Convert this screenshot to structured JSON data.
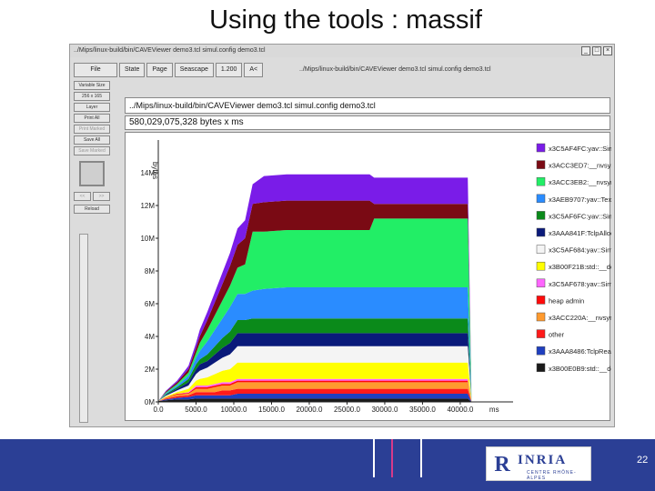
{
  "slide": {
    "title": "Using the tools : massif",
    "page_number": "22",
    "logo_text": "INRIA",
    "logo_sub": "CENTRE RHÔNE-ALPES"
  },
  "window": {
    "title": "../Mips/linux-build/bin/CAVEViewer demo3.tcl simul.config demo3.tcl",
    "buttons": [
      "_",
      "□",
      "×"
    ]
  },
  "menu": {
    "file": "File",
    "state": "State",
    "page": "Page",
    "seascape": "Seascape",
    "zoom": "1.200",
    "back": "A<",
    "path": "../Mips/linux-build/bin/CAVEViewer demo3.tcl simul.config demo3.tcl"
  },
  "sidebar": {
    "buttons": [
      "Variable Size",
      "256 x 165",
      "Layer",
      "Print All",
      "Print Marked",
      "Save All",
      "Save Marked"
    ],
    "arrows": [
      "<<",
      ">>"
    ],
    "reload": "Reload"
  },
  "fields": {
    "path": "../Mips/linux-build/bin/CAVEViewer demo3.tcl simul.config demo3.tcl",
    "bytes": "580,029,075,328 bytes x ms"
  },
  "chart_data": {
    "type": "area",
    "ylabel": "bytes",
    "xlabel": "ms",
    "ylim": [
      0,
      16
    ],
    "xlim": [
      0,
      47000
    ],
    "y_ticks": [
      "0M",
      "2M",
      "4M",
      "6M",
      "8M",
      "10M",
      "12M",
      "14M"
    ],
    "y_tick_values": [
      0,
      2,
      4,
      6,
      8,
      10,
      12,
      14
    ],
    "x_ticks": [
      "0.0",
      "5000.0",
      "10000.0",
      "15000.0",
      "20000.0",
      "25000.0",
      "30000.0",
      "35000.0",
      "40000.0"
    ],
    "x_tick_values": [
      0,
      5000,
      10000,
      15000,
      20000,
      25000,
      30000,
      35000,
      40000
    ],
    "x": [
      0,
      1000,
      2500,
      4000,
      5000,
      5500,
      6500,
      7500,
      8500,
      9500,
      10500,
      11500,
      12500,
      14000,
      17000,
      20000,
      22000,
      24000,
      26000,
      28000,
      28600,
      31000,
      34000,
      37000,
      39000,
      40000,
      41000,
      41500
    ],
    "series": [
      {
        "name": "x3B00E0B9:std::__default_",
        "color": "#1a1a1a",
        "values": [
          0.05,
          0.1,
          0.15,
          0.15,
          0.2,
          0.2,
          0.2,
          0.2,
          0.2,
          0.2,
          0.2,
          0.2,
          0.2,
          0.2,
          0.2,
          0.2,
          0.2,
          0.2,
          0.2,
          0.2,
          0.2,
          0.2,
          0.2,
          0.2,
          0.2,
          0.2,
          0.2,
          0
        ]
      },
      {
        "name": "x3AAA8486:TclpRealloc",
        "color": "#1f3fbf",
        "values": [
          0,
          0.05,
          0.1,
          0.15,
          0.2,
          0.2,
          0.2,
          0.2,
          0.2,
          0.2,
          0.3,
          0.3,
          0.3,
          0.3,
          0.3,
          0.3,
          0.3,
          0.3,
          0.3,
          0.3,
          0.3,
          0.3,
          0.3,
          0.3,
          0.3,
          0.3,
          0.3,
          0
        ]
      },
      {
        "name": "other",
        "color": "#ff1a1a",
        "values": [
          0,
          0.05,
          0.1,
          0.1,
          0.2,
          0.2,
          0.2,
          0.2,
          0.3,
          0.3,
          0.3,
          0.3,
          0.3,
          0.3,
          0.3,
          0.3,
          0.3,
          0.3,
          0.3,
          0.3,
          0.3,
          0.3,
          0.3,
          0.3,
          0.3,
          0.3,
          0.3,
          0
        ]
      },
      {
        "name": "x3ACC220A:__nvsym18144",
        "color": "#ff9a2e",
        "values": [
          0,
          0.05,
          0.1,
          0.1,
          0.2,
          0.2,
          0.2,
          0.3,
          0.3,
          0.3,
          0.4,
          0.4,
          0.4,
          0.4,
          0.4,
          0.4,
          0.4,
          0.4,
          0.4,
          0.4,
          0.4,
          0.4,
          0.4,
          0.4,
          0.4,
          0.4,
          0.4,
          0
        ]
      },
      {
        "name": "heap admin",
        "color": "#ff0a0a",
        "values": [
          0,
          0.02,
          0.05,
          0.05,
          0.1,
          0.1,
          0.1,
          0.1,
          0.1,
          0.1,
          0.1,
          0.1,
          0.1,
          0.1,
          0.1,
          0.1,
          0.1,
          0.1,
          0.1,
          0.1,
          0.1,
          0.1,
          0.1,
          0.1,
          0.1,
          0.1,
          0.1,
          0
        ]
      },
      {
        "name": "x3C5AF678:yav::SimuTetra3",
        "color": "#ff66ff",
        "values": [
          0,
          0,
          0,
          0.05,
          0.1,
          0.1,
          0.1,
          0.1,
          0.1,
          0.1,
          0.1,
          0.1,
          0.1,
          0.1,
          0.1,
          0.1,
          0.1,
          0.1,
          0.1,
          0.1,
          0.1,
          0.1,
          0.1,
          0.1,
          0.1,
          0.1,
          0.1,
          0
        ]
      },
      {
        "name": "x3B00F21B:std::__default_",
        "color": "#ffff00",
        "values": [
          0,
          0.05,
          0.1,
          0.2,
          0.3,
          0.4,
          0.5,
          0.6,
          0.7,
          0.8,
          1.0,
          1.0,
          1.0,
          1.0,
          1.0,
          1.0,
          1.0,
          1.0,
          1.0,
          1.0,
          1.0,
          1.0,
          1.0,
          1.0,
          1.0,
          1.0,
          1.0,
          0
        ]
      },
      {
        "name": "x3C5AF684:yav::SimuTetra3",
        "color": "#f4f4f4",
        "values": [
          0,
          0.05,
          0.1,
          0.2,
          0.4,
          0.5,
          0.6,
          0.7,
          0.8,
          0.9,
          1.0,
          1.0,
          1.0,
          1.0,
          1.0,
          1.0,
          1.0,
          1.0,
          1.0,
          1.0,
          1.0,
          1.0,
          1.0,
          1.0,
          1.0,
          1.0,
          1.0,
          0
        ]
      },
      {
        "name": "x3AAA841F:TclpAlloc",
        "color": "#0a1a7a",
        "values": [
          0,
          0.05,
          0.1,
          0.2,
          0.3,
          0.4,
          0.4,
          0.5,
          0.6,
          0.7,
          0.8,
          0.8,
          0.8,
          0.8,
          0.8,
          0.8,
          0.8,
          0.8,
          0.8,
          0.8,
          0.8,
          0.8,
          0.8,
          0.8,
          0.8,
          0.8,
          0.8,
          0
        ]
      },
      {
        "name": "x3C5AF6FC:yav::SimuTetra3",
        "color": "#0a8a1a",
        "values": [
          0,
          0.05,
          0.1,
          0.2,
          0.3,
          0.3,
          0.4,
          0.5,
          0.6,
          0.7,
          0.8,
          0.8,
          0.9,
          0.9,
          0.9,
          0.9,
          0.9,
          0.9,
          0.9,
          0.9,
          0.9,
          0.9,
          0.9,
          0.9,
          0.9,
          0.9,
          0.9,
          0
        ]
      },
      {
        "name": "x3AEB9707:yav::Texture2D::",
        "color": "#2a8cff",
        "values": [
          0,
          0.05,
          0.1,
          0.2,
          0.4,
          0.5,
          0.8,
          1.0,
          1.2,
          1.5,
          1.6,
          1.6,
          1.7,
          1.8,
          1.9,
          1.9,
          1.9,
          1.9,
          1.9,
          1.9,
          1.9,
          1.9,
          1.9,
          1.9,
          1.9,
          1.9,
          1.9,
          0
        ]
      },
      {
        "name": "x3ACC3EB2:__nvsym18241",
        "color": "#22ee66",
        "values": [
          0,
          0.05,
          0.1,
          0.2,
          0.3,
          0.5,
          0.7,
          0.9,
          1.1,
          1.3,
          1.6,
          1.8,
          3.6,
          3.5,
          3.5,
          3.5,
          3.5,
          3.5,
          3.5,
          3.5,
          4.2,
          4.2,
          4.2,
          4.2,
          4.2,
          4.2,
          4.2,
          0
        ]
      },
      {
        "name": "x3ACC3ED7:__nvsym18242",
        "color": "#7a0a14",
        "values": [
          0,
          0.05,
          0.1,
          0.2,
          0.3,
          0.4,
          0.6,
          0.8,
          1.0,
          1.2,
          1.4,
          1.6,
          1.7,
          1.8,
          1.8,
          1.8,
          1.8,
          1.8,
          1.8,
          1.8,
          0.9,
          0.9,
          0.9,
          0.9,
          0.9,
          0.9,
          0.9,
          0
        ]
      },
      {
        "name": "x3C5AF4FC:yav::SimuTetra3",
        "color": "#7a1ce8",
        "values": [
          0,
          0.05,
          0.1,
          0.2,
          0.3,
          0.4,
          0.5,
          0.6,
          0.7,
          0.8,
          1.0,
          1.1,
          1.2,
          1.6,
          1.6,
          1.6,
          1.6,
          1.6,
          1.6,
          1.6,
          1.6,
          1.6,
          1.6,
          1.6,
          1.6,
          1.6,
          1.6,
          0
        ]
      }
    ],
    "legend": "right",
    "legend_order_top_to_bottom": [
      "x3C5AF4FC:yav::SimuTetra3",
      "x3ACC3ED7:__nvsym18242",
      "x3ACC3EB2:__nvsym18241",
      "x3AEB9707:yav::Texture2D::",
      "x3C5AF6FC:yav::SimuTetra3",
      "x3AAA841F:TclpAlloc",
      "x3C5AF684:yav::SimuTetra3",
      "x3B00F21B:std::__default_",
      "x3C5AF678:yav::SimuTetra3",
      "heap admin",
      "x3ACC220A:__nvsym18144",
      "other",
      "x3AAA8486:TclpRealloc",
      "x3B00E0B9:std::__default_"
    ]
  }
}
